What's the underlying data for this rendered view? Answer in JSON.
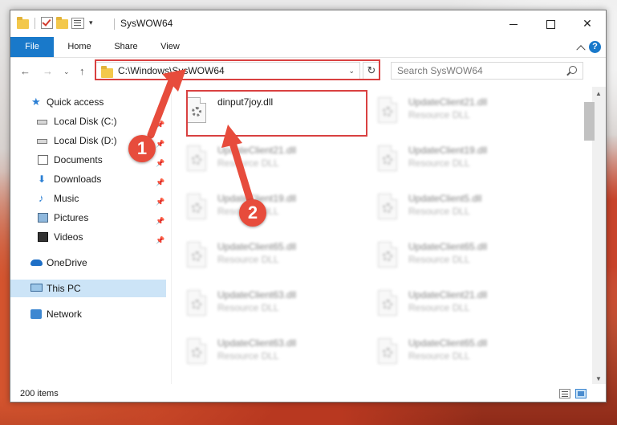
{
  "window": {
    "title": "SysWOW64",
    "controls": {
      "minimize": "",
      "maximize": "",
      "close": "✕"
    }
  },
  "ribbon": {
    "tabs": [
      {
        "label": "File"
      },
      {
        "label": "Home"
      },
      {
        "label": "Share"
      },
      {
        "label": "View"
      }
    ],
    "help": "?"
  },
  "address": {
    "path": "C:\\Windows\\SysWOW64",
    "refresh": "↻",
    "search_placeholder": "Search SysWOW64"
  },
  "nav": {
    "back": "←",
    "forward": "→",
    "recent": "⌄",
    "up": "↑",
    "items": [
      {
        "label": "Quick access",
        "icon": "star-icon"
      },
      {
        "label": "Local Disk (C:)",
        "icon": "drive-icon"
      },
      {
        "label": "Local Disk (D:)",
        "icon": "drive-icon"
      },
      {
        "label": "Documents",
        "icon": "documents-icon"
      },
      {
        "label": "Downloads",
        "icon": "downloads-icon"
      },
      {
        "label": "Music",
        "icon": "music-icon"
      },
      {
        "label": "Pictures",
        "icon": "pictures-icon"
      },
      {
        "label": "Videos",
        "icon": "videos-icon"
      },
      {
        "label": "OneDrive",
        "icon": "cloud-icon"
      },
      {
        "label": "This PC",
        "icon": "computer-icon"
      },
      {
        "label": "Network",
        "icon": "network-icon"
      }
    ]
  },
  "files": [
    {
      "name": "dinput7joy.dll",
      "type": "",
      "highlighted": true
    },
    {
      "name": "UpdateClient21.dll",
      "type": "Resource DLL"
    },
    {
      "name": "UpdateClient21.dll",
      "type": "Resource DLL"
    },
    {
      "name": "UpdateClient19.dll",
      "type": "Resource DLL"
    },
    {
      "name": "UpdateClient19.dll",
      "type": "Resource DLL"
    },
    {
      "name": "UpdateClient5.dll",
      "type": "Resource DLL"
    },
    {
      "name": "UpdateClient65.dll",
      "type": "Resource DLL"
    },
    {
      "name": "UpdateClient65.dll",
      "type": "Resource DLL"
    },
    {
      "name": "UpdateClient63.dll",
      "type": "Resource DLL"
    },
    {
      "name": "UpdateClient21.dll",
      "type": "Resource DLL"
    },
    {
      "name": "UpdateClient63.dll",
      "type": "Resource DLL"
    },
    {
      "name": "UpdateClient65.dll",
      "type": "Resource DLL"
    }
  ],
  "status": {
    "count": "200 items"
  },
  "callouts": {
    "one": "1",
    "two": "2"
  },
  "colors": {
    "accent": "#1979ca",
    "highlight_red": "#d94141",
    "callout_red": "#e74c3c",
    "selected_bg": "#cce4f7"
  }
}
